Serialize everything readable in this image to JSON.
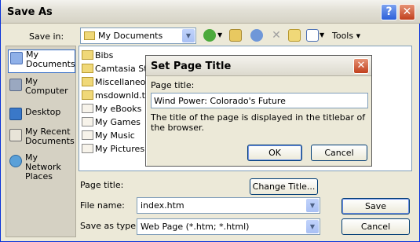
{
  "window": {
    "title": "Save As",
    "help_glyph": "?",
    "close_glyph": "✕"
  },
  "toolbar": {
    "save_in_label": "Save in:",
    "location": "My Documents",
    "tools_label": "Tools ▾",
    "icons": [
      "back-icon",
      "up-folder-icon",
      "search-web-icon",
      "delete-icon",
      "new-folder-icon",
      "views-icon"
    ]
  },
  "places": [
    {
      "label": "My Documents",
      "icon": "my-documents-icon",
      "selected": true
    },
    {
      "label": "My Computer",
      "icon": "my-computer-icon"
    },
    {
      "label": "Desktop",
      "icon": "desktop-icon"
    },
    {
      "label": "My Recent Documents",
      "icon": "recent-documents-icon"
    },
    {
      "label": "My Network Places",
      "icon": "network-places-icon"
    }
  ],
  "files": [
    {
      "name": "Bibs",
      "type": "folder"
    },
    {
      "name": "Camtasia Stu",
      "type": "folder"
    },
    {
      "name": "Miscellaneous",
      "type": "folder"
    },
    {
      "name": "msdownld.tmp",
      "type": "folder"
    },
    {
      "name": "My eBooks",
      "type": "folder"
    },
    {
      "name": "My Games",
      "type": "folder"
    },
    {
      "name": "My Music",
      "type": "folder"
    },
    {
      "name": "My Pictures",
      "type": "folder"
    }
  ],
  "bottom": {
    "page_title_label": "Page title:",
    "change_title_button": "Change Title...",
    "file_name_label": "File name:",
    "file_name_value": "index.htm",
    "save_type_label": "Save as type:",
    "save_type_value": "Web Page (*.htm; *.html)",
    "save_button": "Save",
    "cancel_button": "Cancel"
  },
  "dialog": {
    "title": "Set Page Title",
    "close_glyph": "✕",
    "field_label": "Page title:",
    "field_value": "Wind Power: Colorado's Future",
    "description": "The title of the page is displayed in the titlebar of the browser.",
    "ok_button": "OK",
    "cancel_button": "Cancel"
  }
}
